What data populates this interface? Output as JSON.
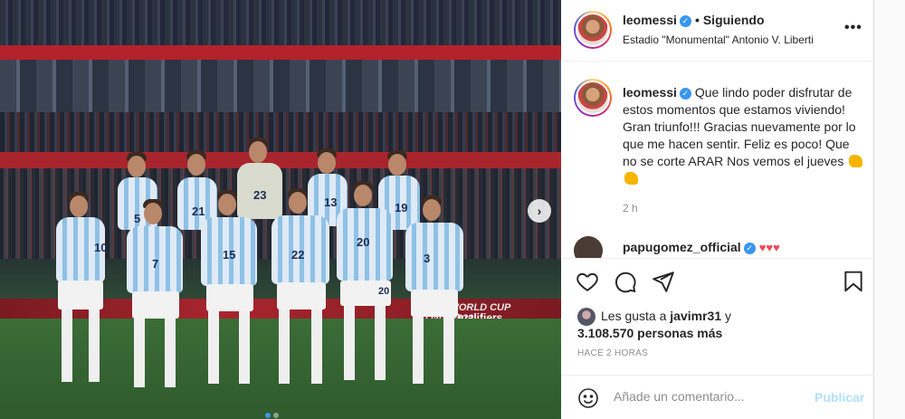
{
  "post": {
    "username": "leomessi",
    "follow_separator": "•",
    "follow_status": "Siguiendo",
    "location": "Estadio \"Monumental\" Antonio V. Liberti",
    "more_icon": "ellipsis-icon"
  },
  "media": {
    "board_text_1": "FIFA WORLD CUP Qatar2022",
    "board_text_2": "Qualifiers",
    "jersey_numbers": [
      "5",
      "23",
      "13",
      "19",
      "21",
      "15",
      "22",
      "20",
      "3",
      "7",
      "20",
      "10"
    ],
    "next_icon": "chevron-right-icon",
    "slide_count": 2,
    "active_slide": 1
  },
  "caption": {
    "username": "leomessi",
    "text": "Que lindo poder disfrutar de estos momentos que estamos viviendo! Gran triunfo!!! Gracias nuevamente por lo que me hacen sentir. Feliz es poco! Que no se corte ARAR Nos vemos el jueves",
    "time": "2 h"
  },
  "comment_preview": {
    "username": "papugomez_official",
    "hearts": "♥♥♥"
  },
  "likes": {
    "prefix": "Les gusta a",
    "user": "javimr31",
    "connector": "y",
    "count": "3.108.570 personas más"
  },
  "time_ago": "HACE 2 HORAS",
  "compose": {
    "placeholder": "Añade un comentario...",
    "publish_label": "Publicar"
  },
  "colors": {
    "accent_blue": "#3897f0",
    "publish_disabled": "#b2dffc",
    "heart_red": "#ed4956"
  }
}
